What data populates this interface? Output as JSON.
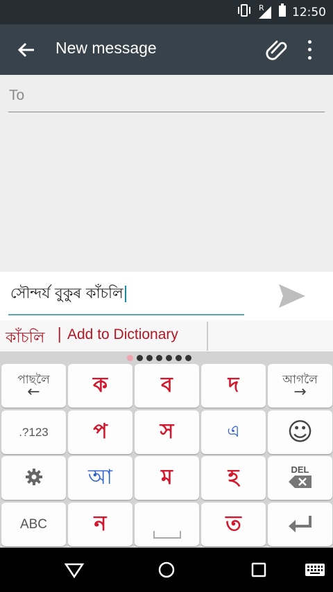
{
  "status": {
    "time": "12:50",
    "roaming": "R"
  },
  "appbar": {
    "title": "New message"
  },
  "to": {
    "label": "To"
  },
  "compose": {
    "text": "সৌন্দৰ্য বুকুৰ কাঁচলি"
  },
  "suggestion": {
    "word": "কাঁচলি",
    "separator": "|",
    "add": "Add to Dictionary"
  },
  "keyboard": {
    "row1": {
      "prev_label": "পাছলৈ",
      "prev_arrow": "←",
      "k1": "ক",
      "k2": "ব",
      "k3": "দ",
      "next_label": "আগলৈ",
      "next_arrow": "→"
    },
    "row2": {
      "num": ".?123",
      "k1": "প",
      "k2": "স",
      "k3": "এ",
      "emoji": "☺"
    },
    "row3": {
      "k1": "আ",
      "k2": "ম",
      "k3": "হ",
      "del": "DEL"
    },
    "row4": {
      "abc": "ABC",
      "k1": "ন",
      "k3": "ত",
      "enter": "↵"
    }
  },
  "colors": {
    "appbar": "#37424a",
    "statusbar": "#262d33",
    "accent_red": "#d0192f",
    "accent_blue": "#2a5fd0"
  }
}
